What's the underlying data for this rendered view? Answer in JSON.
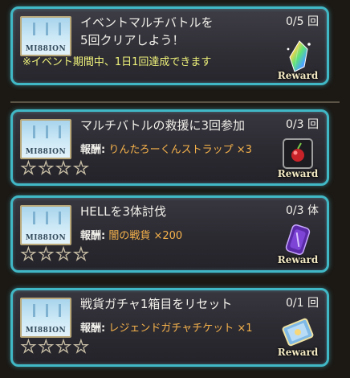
{
  "missions": [
    {
      "title_line1": "イベントマルチバトルを",
      "title_line2": "5回クリアしよう！",
      "count": "0/5 回",
      "notice": "※イベント期間中、1日1回達成できます",
      "thumb_label": "MI88ION",
      "reward_label": "Reward",
      "reward_icon": "rainbow-crystal-icon"
    },
    {
      "title": "マルチバトルの救援に3回参加",
      "count": "0/3 回",
      "reward_key": "報酬:",
      "reward_name": "りんたろーくんストラップ ×3",
      "thumb_label": "MI88ION",
      "reward_label": "Reward",
      "reward_icon": "strap-charm-icon",
      "stars": 0
    },
    {
      "title": "HELLを3体討伐",
      "count": "0/3 体",
      "reward_key": "報酬:",
      "reward_name": "闇の戦貨 ×200",
      "thumb_label": "MI88ION",
      "reward_label": "Reward",
      "reward_icon": "dark-medal-icon",
      "stars": 0
    },
    {
      "title": "戦貨ガチャ1箱目をリセット",
      "count": "0/1 回",
      "reward_key": "報酬:",
      "reward_name": "レジェンドガチャチケット ×1",
      "thumb_label": "MI88ION",
      "reward_label": "Reward",
      "reward_icon": "gacha-ticket-icon",
      "stars": 0
    }
  ]
}
